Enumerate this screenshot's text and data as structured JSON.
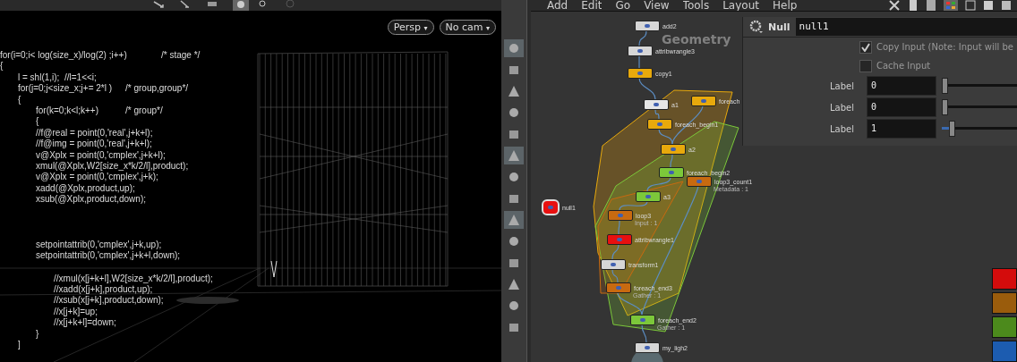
{
  "viewport": {
    "camera_buttons": [
      {
        "label": "Persp",
        "caret": "▾"
      },
      {
        "label": "No cam",
        "caret": "▾"
      }
    ],
    "code_blocks": [
      [
        "for(i=0;i< log(size_x)/log(2) ;i++)\t\t/* stage */",
        "{",
        "\tl = shl(1,i);  //l=1<<i;",
        "\tfor(j=0;j<size_x;j+= 2*l )\t/* group,group*/",
        "\t{",
        "\t\tfor(k=0;k<l;k++)\t\t/* group*/",
        "\t\t{",
        "\t\t//f@real = point(0,'real',j+k+l);",
        "\t\t//f@img = point(0,'real',j+k+l);",
        "\t\tv@Xplx = point(0,'cmplex',j+k+l);",
        "\t\txmul(@Xplx,W2[size_x*k/2/l],product);",
        "\t\tv@Xplx = point(0,'cmplex',j+k);",
        "\t\txadd(@Xplx,product,up);",
        "\t\txsub(@Xplx,product,down);"
      ],
      [
        "\t\tsetpointattrib(0,'cmplex',j+k,up);",
        "\t\tsetpointattrib(0,'cmplex',j+k+l,down);"
      ],
      [
        "\t\t\t//xmul(x[j+k+l],W2[size_x*k/2/l],product);",
        "\t\t\t//xadd(x[j+k],product,up);",
        "\t\t\t//xsub(x[j+k],product,down);",
        "\t\t\t//x[j+k]=up;",
        "\t\t\t//x[j+k+l]=down;",
        "\t\t}",
        "\t]"
      ]
    ]
  },
  "tool_shelf": [
    {
      "selected": true
    },
    {
      "selected": false
    },
    {
      "selected": false
    },
    {
      "selected": false
    },
    {
      "selected": false
    },
    {
      "selected": true
    },
    {
      "selected": false
    },
    {
      "selected": false
    },
    {
      "selected": true
    },
    {
      "selected": false
    },
    {
      "selected": false
    },
    {
      "selected": false
    },
    {
      "selected": false
    },
    {
      "selected": false
    }
  ],
  "network": {
    "menu": [
      "Add",
      "Edit",
      "Go",
      "View",
      "Tools",
      "Layout",
      "Help"
    ],
    "context_label": "Geometry",
    "nodes": [
      {
        "label": "add2",
        "color": "#d6d6d6"
      },
      {
        "label": "attribwrangle3",
        "color": "#d6d6d6"
      },
      {
        "label": "copy1",
        "color": "#e8a90c"
      },
      {
        "label": "a1",
        "color": "#e6e6e6"
      },
      {
        "label": "foreach",
        "color": "#e8a90c"
      },
      {
        "label": "foreach_begin1",
        "color": "#e8a90c"
      },
      {
        "label": "a2",
        "color": "#e8a90c"
      },
      {
        "label": "foreach_begin2",
        "color": "#7cc83a"
      },
      {
        "label": "loop3_count1",
        "color": "#c86a10",
        "note": "Metadata : 1"
      },
      {
        "label": "a3",
        "color": "#7cc83a"
      },
      {
        "label": "loop3",
        "color": "#c86a10",
        "note": "Input : 1"
      },
      {
        "label": "attribwrangle1",
        "color": "#e81010"
      },
      {
        "label": "transform1",
        "color": "#d6d6d6"
      },
      {
        "label": "foreach_end3",
        "color": "#c86a10",
        "note": "Gather : 1"
      },
      {
        "label": "foreach_end2",
        "color": "#7cc83a",
        "note": "Gather : 1"
      },
      {
        "label": "my_ligh2",
        "color": "#d6d6d6"
      },
      {
        "label": "null1",
        "color": "#e81010"
      }
    ],
    "swatches": [
      {
        "color": "#d40c0c"
      },
      {
        "color": "#9a5c0c"
      },
      {
        "color": "#4c8a1c"
      },
      {
        "color": "#1c5cb0"
      }
    ]
  },
  "parameters": {
    "type": "Null",
    "name": "null1",
    "toggles": [
      {
        "label": "Copy Input (Note: Input will be",
        "checked": true
      },
      {
        "label": "Cache Input",
        "checked": false
      }
    ],
    "fields": [
      {
        "label": "Label",
        "value": "0",
        "level": 0
      },
      {
        "label": "Label",
        "value": "0",
        "level": 0
      },
      {
        "label": "Label",
        "value": "1",
        "level": 0.1
      }
    ]
  }
}
